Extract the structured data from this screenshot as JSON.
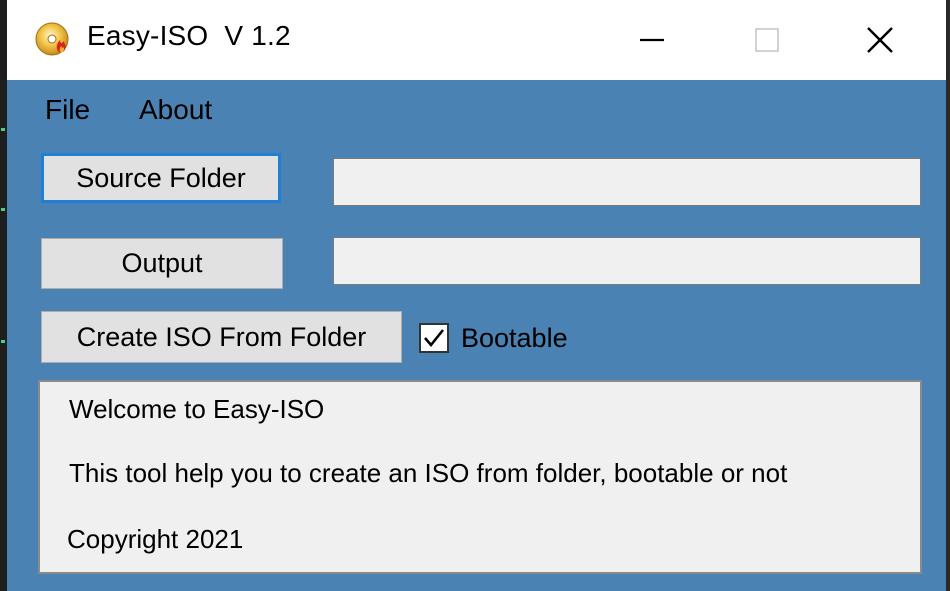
{
  "window": {
    "title": "Easy-ISO  V 1.2",
    "app_icon": "disc-flame-icon",
    "controls": {
      "minimize": "minimize-icon",
      "maximize": "maximize-icon",
      "close": "close-icon"
    }
  },
  "menu": {
    "items": [
      {
        "label": "File"
      },
      {
        "label": "About"
      }
    ]
  },
  "form": {
    "source_button": "Source Folder",
    "source_value": "",
    "output_button": "Output",
    "output_value": "",
    "create_button": "Create ISO From Folder",
    "bootable_label": "Bootable",
    "bootable_checked": true
  },
  "info": {
    "lines": [
      "Welcome to Easy-ISO",
      "This tool help you to create an ISO from folder, bootable or not",
      "Copyright 2021"
    ]
  },
  "colors": {
    "client_bg": "#4a82b4",
    "focus_border": "#1f7fd6",
    "button_bg": "#e1e1e1",
    "field_bg": "#f0f0f0"
  }
}
